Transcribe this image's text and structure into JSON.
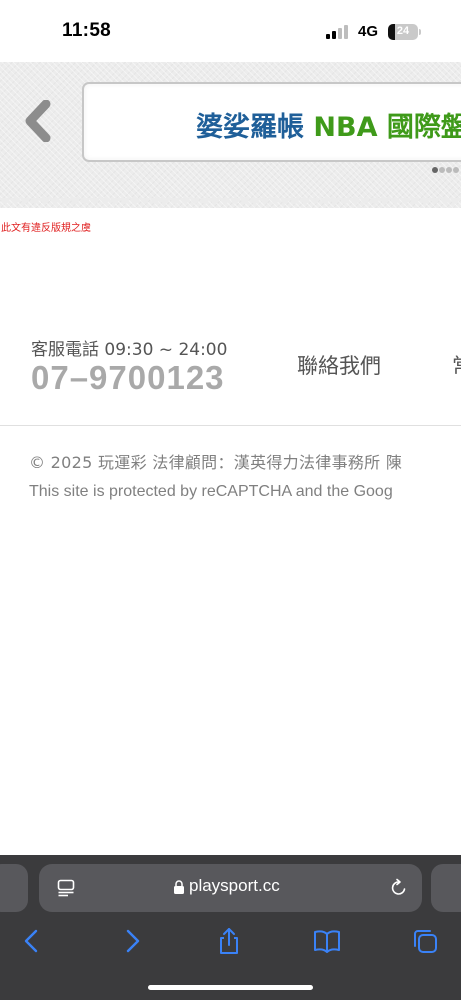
{
  "status_bar": {
    "time": "11:58",
    "network": "4G",
    "battery_level": "24"
  },
  "banner": {
    "marquee_part1": "婆娑羅帳",
    "marquee_part2": "NBA 國際盤",
    "slides_total": 4,
    "active_slide": 1,
    "colors": {
      "part1": "#1f5f99",
      "part2": "#3f9a1a"
    }
  },
  "notice": "此文有違反版規之虞",
  "footer": {
    "hotline_label": "客服電話 09:30 ~ 24:00",
    "hotline_number": "07–9700123",
    "contact_link": "聯絡我們",
    "next_link_partial": "常",
    "copyright": "© 2025 玩運彩 法律顧問：漢英得力法律事務所 陳",
    "recaptcha": "This site is protected by reCAPTCHA and the Goog"
  },
  "browser": {
    "url": "playsport.cc",
    "icons": [
      "reader-icon",
      "lock-icon",
      "reload-icon",
      "back-icon",
      "forward-icon",
      "share-icon",
      "bookmarks-icon",
      "tabs-icon"
    ]
  }
}
